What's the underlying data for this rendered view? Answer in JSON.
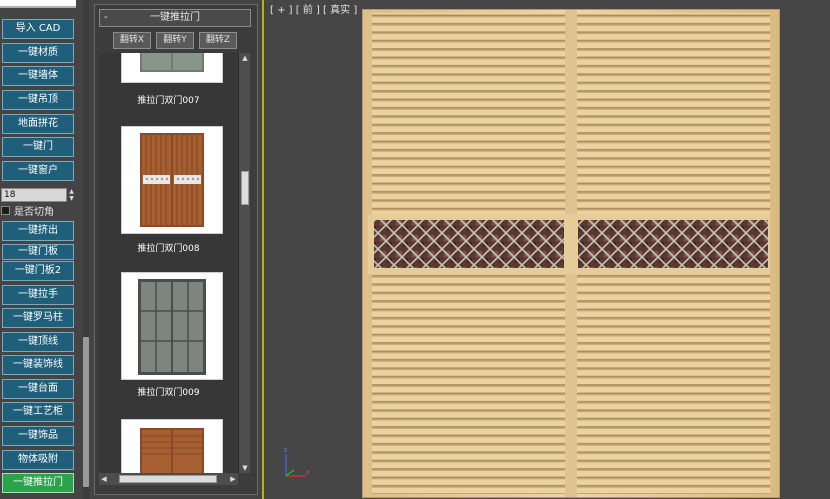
{
  "sidebar": {
    "tools": [
      "导入 CAD",
      "一键材质",
      "一键墙体",
      "一键吊顶",
      "地面拼花",
      "一键门",
      "一键窗户",
      "一键挤出",
      "一键门板",
      "一键门板2",
      "一键拉手",
      "一键罗马柱",
      "一键顶线",
      "一键装饰线",
      "一键台面",
      "一键工艺柜",
      "一键饰品",
      "物体吸附",
      "一键推拉门"
    ],
    "spinner_value": "18",
    "chamfer_label": "是否切角",
    "active_tool": "一键推拉门"
  },
  "library": {
    "minus": "-",
    "title": "一键推拉门",
    "flip_x": "翻转X",
    "flip_y": "翻转Y",
    "flip_z": "翻转Z",
    "items": [
      "推拉门双门007",
      "推拉门双门008",
      "推拉门双门009"
    ]
  },
  "viewport": {
    "label": "[ + ] [ 前 ] [ 真实 ]",
    "axis_labels": {
      "z": "z",
      "x": "x"
    }
  },
  "colors": {
    "tool_button": "#1f5f7a",
    "tool_button_active": "#2aa34a",
    "viewport_border": "#c2b200",
    "wood": "#e8cf9a"
  }
}
